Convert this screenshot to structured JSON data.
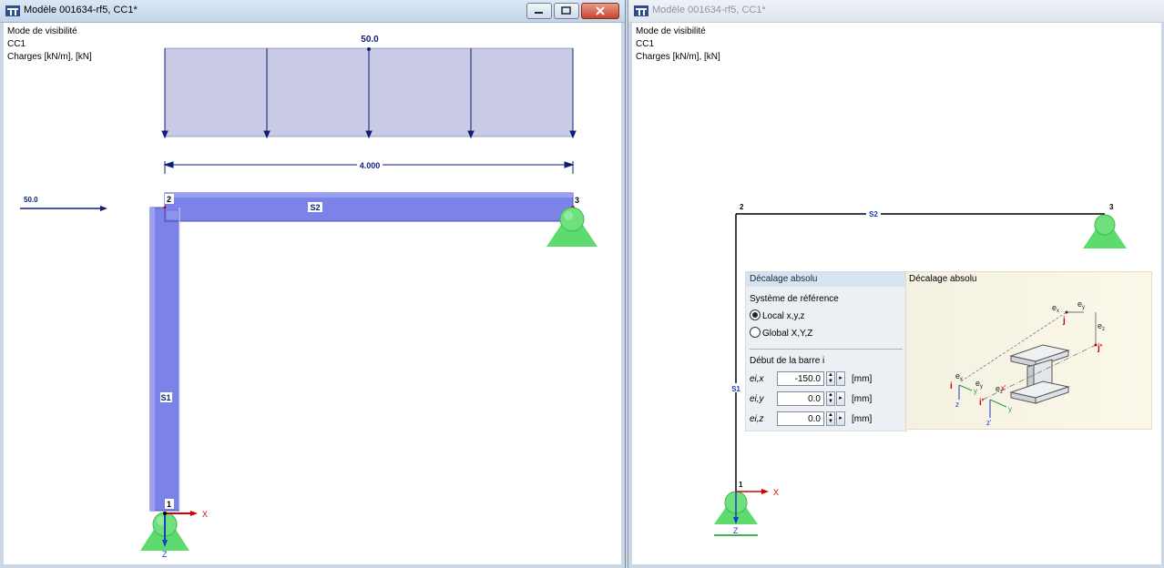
{
  "left_window": {
    "title": "Modèle 001634-rf5, CC1*",
    "info": [
      "Mode de visibilité",
      "CC1",
      "Charges [kN/m], [kN]"
    ],
    "load_value_top": "50.0",
    "load_value_side": "50.0",
    "dimension": "4.000",
    "member_labels": [
      "S1",
      "S2"
    ],
    "node_labels": [
      "1",
      "2",
      "3"
    ],
    "axis_x": "X",
    "axis_z": "Z"
  },
  "right_window": {
    "title": "Modèle 001634-rf5, CC1*",
    "info": [
      "Mode de visibilité",
      "CC1",
      "Charges [kN/m], [kN]"
    ],
    "member_labels": [
      "S1",
      "S2"
    ],
    "node_labels": [
      "1",
      "2",
      "3"
    ],
    "axis_x": "X",
    "axis_z": "Z"
  },
  "dialog": {
    "header": "Décalage absolu",
    "ref_system_label": "Système de référence",
    "options": [
      "Local x,y,z",
      "Global X,Y,Z"
    ],
    "selected_option": "Local x,y,z",
    "section_label": "Début de la barre i",
    "fields": [
      {
        "label": "ei,x",
        "value": "-150.0",
        "unit": "[mm]"
      },
      {
        "label": "ei,y",
        "value": "0.0",
        "unit": "[mm]"
      },
      {
        "label": "ei,z",
        "value": "0.0",
        "unit": "[mm]"
      }
    ],
    "figure_title": "Décalage absolu",
    "figure_labels": [
      "ex",
      "ey",
      "ez",
      "ex",
      "ey",
      "ez",
      "j",
      "j'",
      "i",
      "i'",
      "x'",
      "y",
      "y",
      "z",
      "z'"
    ]
  },
  "colors": {
    "load_fill": "#c9cbe6",
    "load_arrow": "#0b1f7a",
    "member_fill": "#7b83e8",
    "support": "#5ddb6f",
    "node_red": "#c00000",
    "axis_x": "#d40000",
    "axis_z": "#1b3cc4"
  }
}
